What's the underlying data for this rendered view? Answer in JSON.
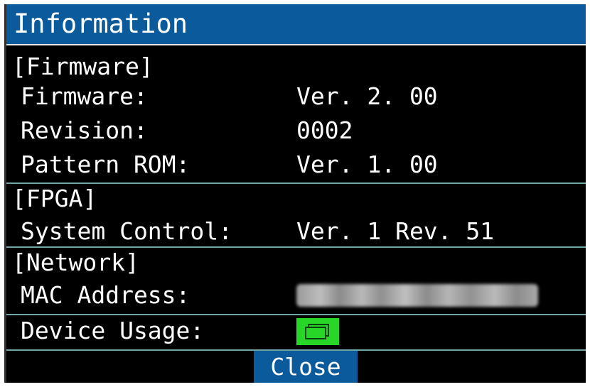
{
  "title": "Information",
  "sections": {
    "firmware": {
      "header": "[Firmware]",
      "rows": [
        {
          "label": "Firmware:",
          "value": "Ver. 2. 00"
        },
        {
          "label": "Revision:",
          "value": "0002"
        },
        {
          "label": "Pattern ROM:",
          "value": "Ver. 1. 00"
        }
      ]
    },
    "fpga": {
      "header": "[FPGA]",
      "rows": [
        {
          "label": "System Control:",
          "value": "Ver. 1 Rev. 51"
        }
      ]
    },
    "network": {
      "header": "[Network]",
      "rows": [
        {
          "label": "MAC Address:",
          "value": ""
        },
        {
          "label": "Device Usage:",
          "icon": "device-usage-icon"
        }
      ]
    }
  },
  "close_button": "Close",
  "colors": {
    "title_bar": "#0a5a9c",
    "background": "#000000",
    "text": "#ffffff",
    "separator": "#6fa6a6",
    "usage_icon": "#27d627"
  }
}
